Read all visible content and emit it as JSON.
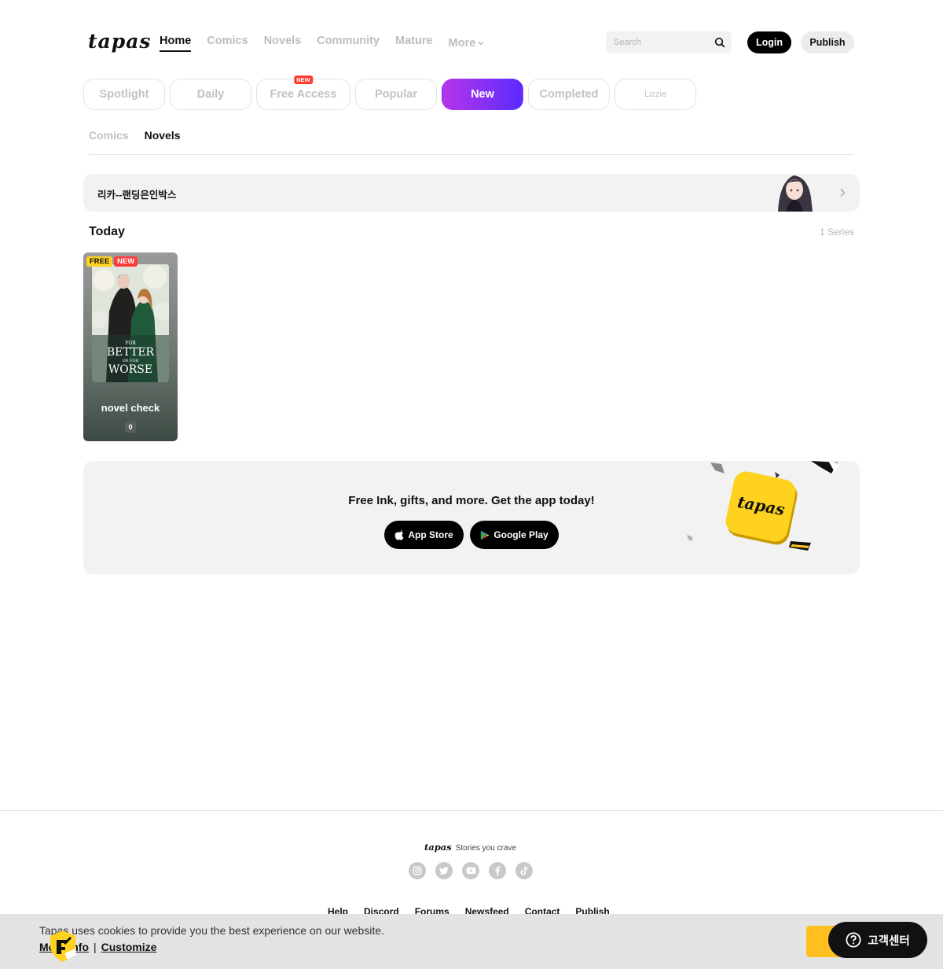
{
  "header": {
    "logo": "tapas",
    "nav": [
      "Home",
      "Comics",
      "Novels",
      "Community",
      "Mature"
    ],
    "more_label": "More",
    "search_placeholder": "Search",
    "login_label": "Login",
    "publish_label": "Publish"
  },
  "tabs": {
    "spotlight": "Spotlight",
    "daily": "Daily",
    "free_access": "Free Access",
    "free_access_badge": "NEW",
    "popular": "Popular",
    "new": "New",
    "completed": "Completed",
    "lizzie": "Lizzie"
  },
  "subtabs": [
    "Comics",
    "Novels"
  ],
  "banner": {
    "text": "리카--랜딩은인박스"
  },
  "today": {
    "heading": "Today",
    "series_count": "1 Series",
    "card": {
      "badge_free": "FREE",
      "badge_new": "NEW",
      "cover_line1": "FOR",
      "cover_line2": "BETTER",
      "cover_line3": "OR FOR",
      "cover_line4": "WORSE",
      "title": "novel check",
      "count": "0"
    }
  },
  "promo": {
    "text": "Free Ink, gifts, and more. Get the app today!",
    "app_store": "App Store",
    "google_play": "Google Play",
    "art_logo": "tapas"
  },
  "footer": {
    "logo": "tapas",
    "tagline": "Stories you crave",
    "links": [
      "Help",
      "Discord",
      "Forums",
      "Newsfeed",
      "Contact",
      "Publish"
    ]
  },
  "cookie": {
    "text": "Tapas uses cookies to provide you the best experience on our website.",
    "more_info": "More info",
    "separator": "|",
    "customize": "Customize"
  },
  "help": {
    "label": "고객센터"
  },
  "colors": {
    "accent_gradient_start": "#b636e8",
    "accent_gradient_end": "#5b2bff",
    "badge_yellow": "#ffd21f",
    "badge_red": "#ff3b3b",
    "cookie_accept": "#ffc01f"
  }
}
